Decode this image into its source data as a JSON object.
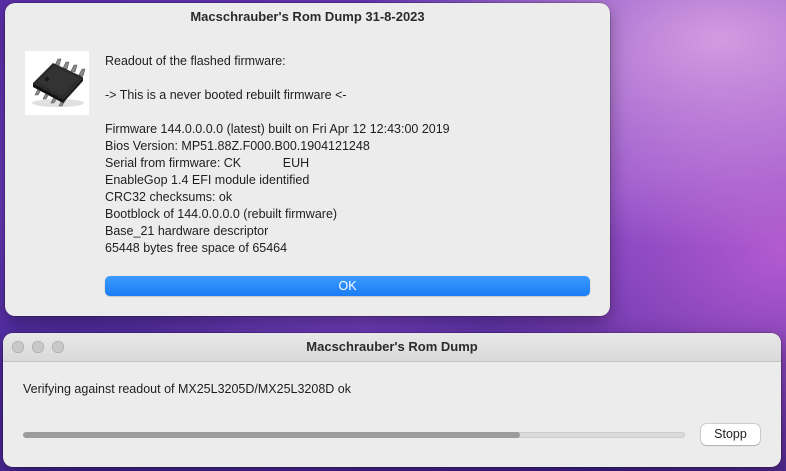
{
  "colors": {
    "accent": "#1a7cf5",
    "window_background": "#ececec",
    "progress_fill": "#9c9c9c"
  },
  "dialog": {
    "title": "Macschrauber's Rom Dump 31-8-2023",
    "icon": "eeprom-chip-icon",
    "message_lines": [
      "Readout of the flashed firmware:",
      "",
      "-> This is a never booted rebuilt firmware <-",
      "",
      "Firmware 144.0.0.0.0 (latest) built on Fri Apr 12 12:43:00 2019",
      "Bios Version: MP51.88Z.F000.B00.1904121248",
      "Serial from firmware: CK            EUH",
      "EnableGop 1.4 EFI module identified",
      "CRC32 checksums: ok",
      "Bootblock of 144.0.0.0.0 (rebuilt firmware)",
      "Base_21 hardware descriptor",
      "65448 bytes free space of 65464"
    ],
    "ok_label": "OK"
  },
  "progress_window": {
    "title": "Macschrauber's Rom Dump",
    "status_text": "Verifying against readout of MX25L3205D/MX25L3208D ok",
    "progress_fraction": 0.75,
    "stop_label": "Stopp"
  }
}
